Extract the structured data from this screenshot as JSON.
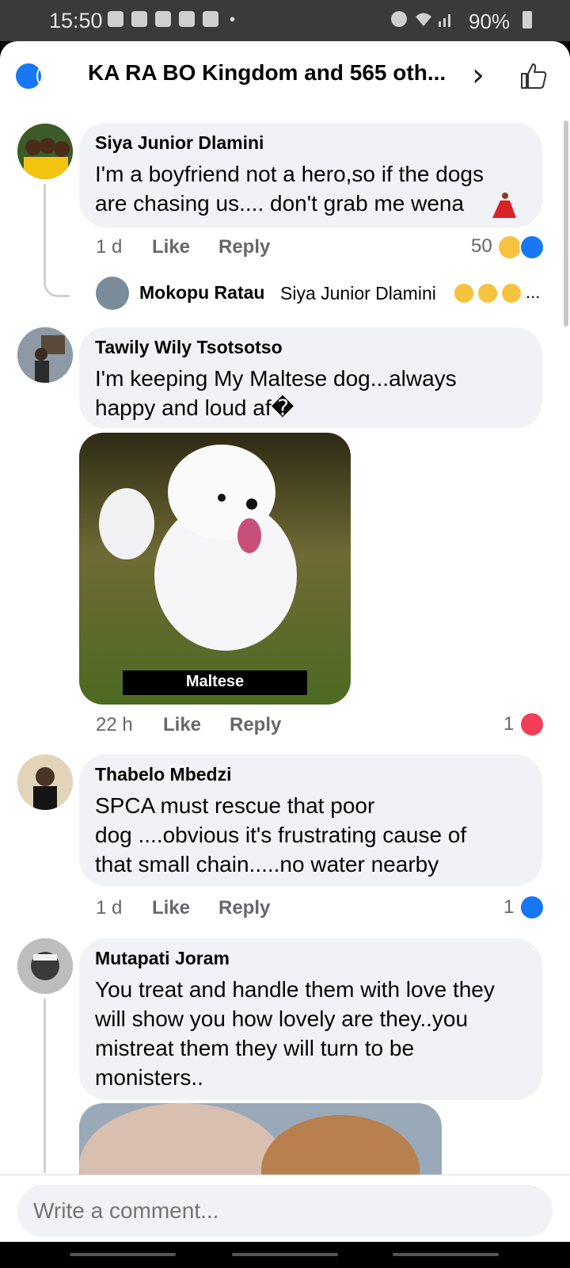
{
  "status_bar": {
    "time": "15:50",
    "battery": "90%"
  },
  "header": {
    "title": "KA RA BO Kingdom and 565 oth...",
    "reactions": [
      "like-icon",
      "laugh-icon",
      "wow-icon"
    ]
  },
  "comments": [
    {
      "name": "Siya Junior Dlamini",
      "lines": [
        "I'm a boyfriend not a hero,so if the dogs",
        "are chasing us.... don't grab me wena"
      ],
      "time": "1 d",
      "like": "Like",
      "reply": "Reply",
      "reaction_count": "50"
    },
    {
      "name": "Tawily Wily Tsotsotso",
      "lines": [
        "I'm keeping My Maltese dog...always",
        "happy and loud af�"
      ],
      "image_caption": "Maltese",
      "time": "22 h",
      "like": "Like",
      "reply": "Reply",
      "reaction_count": "1"
    },
    {
      "name": "Thabelo Mbedzi",
      "lines": [
        "SPCA must rescue that poor",
        "dog ....obvious it's frustrating cause of",
        "that small chain.....no water nearby"
      ],
      "time": "1 d",
      "like": "Like",
      "reply": "Reply",
      "reaction_count": "1"
    },
    {
      "name": "Mutapati Joram",
      "lines": [
        "You treat and handle them with love they",
        "will show you how lovely are they..you",
        "mistreat them they will turn to be",
        "monisters.."
      ]
    }
  ],
  "reply_preview": {
    "name": "Mokopu Ratau",
    "text": "Siya Junior Dlamini",
    "ellipsis": "..."
  },
  "comment_box": {
    "placeholder": "Write a comment..."
  }
}
